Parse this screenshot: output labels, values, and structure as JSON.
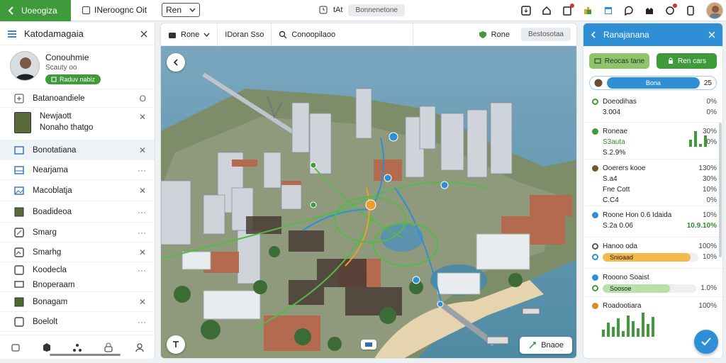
{
  "topbar": {
    "back_label": "Uoeogiza",
    "check_label": "INeroognc Oit",
    "dropdown_value": "Ren",
    "center_icon_label": "tAt",
    "center_pill": "Bonnenetone"
  },
  "left": {
    "title": "Katodamagaia",
    "profile": {
      "name": "Conouhmie",
      "role": "Scauty oo",
      "badge": "Raduv nabiz"
    },
    "rows": [
      {
        "label": "Batanoandiele",
        "action": "O"
      },
      {
        "label": "Newjaott",
        "sub": "Nonaho thatgo",
        "action": "✕"
      },
      {
        "label": "Bonotatiana",
        "action": "✕"
      },
      {
        "label": "Nearjama",
        "action": "···"
      },
      {
        "label": "Macoblatja",
        "action": "✕"
      },
      {
        "label": "Boadideoa",
        "action": "···"
      },
      {
        "label": "Smarg",
        "action": "···"
      },
      {
        "label": "Smarhg",
        "action": "✕"
      },
      {
        "label": "Koodecla",
        "action": "···"
      },
      {
        "label": "Bnoperaam",
        "action": ""
      },
      {
        "label": "Bonagam",
        "action": "✕"
      },
      {
        "label": "Boelolt",
        "action": "···"
      }
    ]
  },
  "map": {
    "toolbar": {
      "first": "Rone",
      "second": "IDoran Sso",
      "third": "Conoopilaoo",
      "fourth": "Rone",
      "pill": "Bestosotaa"
    },
    "action_label": "Bnaoe"
  },
  "right": {
    "title": "Ranajanana",
    "btn1": "Reocas tane",
    "btn2": "Ren cars",
    "search_value": "Bona",
    "search_suffix": "25",
    "items": [
      {
        "title": "Doeodihas",
        "sub": "3.004",
        "val1": "0%",
        "val2": "0%"
      },
      {
        "title": "Roneae",
        "sub": "S3auta",
        "sub2": "S.2.9%",
        "val1": "30%",
        "val2": "0%"
      },
      {
        "title": "Ooerers kooe",
        "sub": "S.a4",
        "title2": "Fne Cott",
        "sub2": "C.C4",
        "val1": "130%",
        "val2": "30%",
        "val3": "10%",
        "val4": "0%"
      },
      {
        "title": "Roone Hon 0.6 Idaida",
        "sub": "S.2a 0.06",
        "val1": "10%",
        "val2": "10.9.10%"
      },
      {
        "title": "Hanoo oda",
        "progress_label": "Snioaad",
        "val1": "100%",
        "val2": "10%",
        "progress_fill": 0.92
      },
      {
        "title": "Rooono Soaist",
        "progress_label": "Soosoe",
        "val1": "",
        "val2": "1.0%",
        "progress_fill": 0.72
      },
      {
        "title": "Roadootiara",
        "val1": "100%"
      }
    ]
  }
}
